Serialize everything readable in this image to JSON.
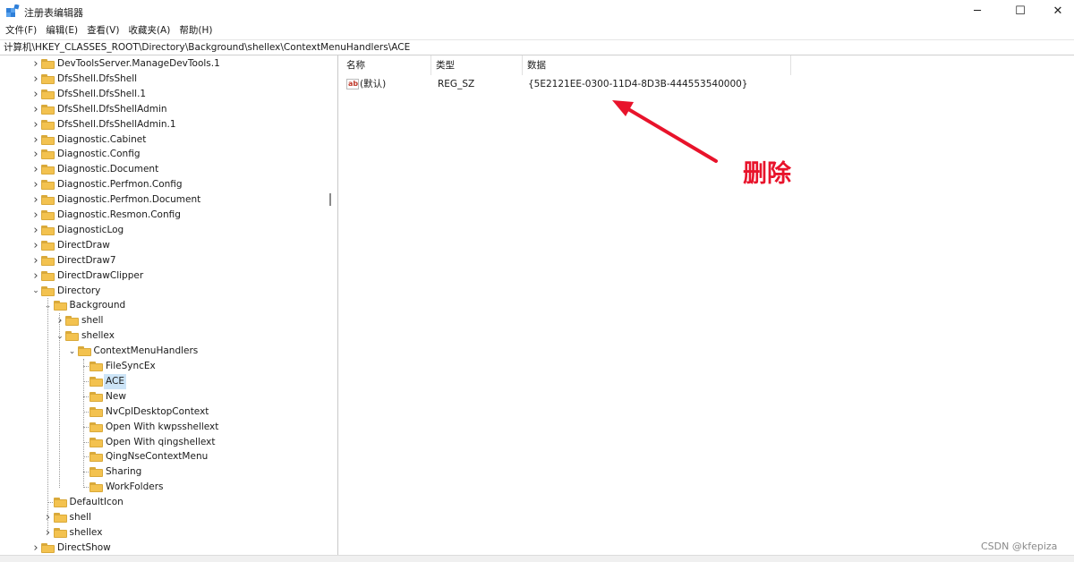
{
  "window": {
    "title": "注册表编辑器",
    "controls": {
      "minimize": "─",
      "maximize": "☐",
      "close": "✕"
    }
  },
  "menu": [
    "文件(F)",
    "编辑(E)",
    "查看(V)",
    "收藏夹(A)",
    "帮助(H)"
  ],
  "address": "计算机\\HKEY_CLASSES_ROOT\\Directory\\Background\\shellex\\ContextMenuHandlers\\ACE",
  "tree": [
    {
      "label": "DevToolsServer.ManageDevTools.1",
      "expander": "collapsed",
      "level": 0
    },
    {
      "label": "DfsShell.DfsShell",
      "expander": "collapsed",
      "level": 0
    },
    {
      "label": "DfsShell.DfsShell.1",
      "expander": "collapsed",
      "level": 0
    },
    {
      "label": "DfsShell.DfsShellAdmin",
      "expander": "collapsed",
      "level": 0
    },
    {
      "label": "DfsShell.DfsShellAdmin.1",
      "expander": "collapsed",
      "level": 0
    },
    {
      "label": "Diagnostic.Cabinet",
      "expander": "collapsed",
      "level": 0
    },
    {
      "label": "Diagnostic.Config",
      "expander": "collapsed",
      "level": 0
    },
    {
      "label": "Diagnostic.Document",
      "expander": "collapsed",
      "level": 0
    },
    {
      "label": "Diagnostic.Perfmon.Config",
      "expander": "collapsed",
      "level": 0
    },
    {
      "label": "Diagnostic.Perfmon.Document",
      "expander": "collapsed",
      "level": 0
    },
    {
      "label": "Diagnostic.Resmon.Config",
      "expander": "collapsed",
      "level": 0
    },
    {
      "label": "DiagnosticLog",
      "expander": "collapsed",
      "level": 0
    },
    {
      "label": "DirectDraw",
      "expander": "collapsed",
      "level": 0
    },
    {
      "label": "DirectDraw7",
      "expander": "collapsed",
      "level": 0
    },
    {
      "label": "DirectDrawClipper",
      "expander": "collapsed",
      "level": 0
    },
    {
      "label": "Directory",
      "expander": "expanded",
      "level": 0
    },
    {
      "label": "Background",
      "expander": "expanded",
      "level": 1
    },
    {
      "label": "shell",
      "expander": "collapsed",
      "level": 2
    },
    {
      "label": "shellex",
      "expander": "expanded",
      "level": 2
    },
    {
      "label": "ContextMenuHandlers",
      "expander": "expanded",
      "level": 3
    },
    {
      "label": "FileSyncEx",
      "expander": "none",
      "level": 4
    },
    {
      "label": "ACE",
      "expander": "none",
      "level": 4,
      "selected": true
    },
    {
      "label": "New",
      "expander": "none",
      "level": 4
    },
    {
      "label": "NvCplDesktopContext",
      "expander": "none",
      "level": 4
    },
    {
      "label": "Open With kwpsshellext",
      "expander": "none",
      "level": 4
    },
    {
      "label": "Open With qingshellext",
      "expander": "none",
      "level": 4
    },
    {
      "label": "QingNseContextMenu",
      "expander": "none",
      "level": 4
    },
    {
      "label": "Sharing",
      "expander": "none",
      "level": 4
    },
    {
      "label": "WorkFolders",
      "expander": "none",
      "level": 4
    },
    {
      "label": "DefaultIcon",
      "expander": "none",
      "level": 1
    },
    {
      "label": "shell",
      "expander": "collapsed",
      "level": 1
    },
    {
      "label": "shellex",
      "expander": "collapsed",
      "level": 1
    },
    {
      "label": "DirectShow",
      "expander": "collapsed",
      "level": 0
    }
  ],
  "values": {
    "columns": [
      "名称",
      "类型",
      "数据"
    ],
    "rows": [
      {
        "name": "(默认)",
        "type": "REG_SZ",
        "data": "{5E2121EE-0300-11D4-8D3B-444553540000}",
        "icon": "string-value-icon"
      }
    ]
  },
  "annotation": {
    "text": "删除",
    "color": "#e8132b"
  },
  "watermark": "CSDN @kfepiza",
  "colors": {
    "selection": "#cce4f7",
    "folder": "#f3c24f",
    "accent": "#e8132b"
  }
}
